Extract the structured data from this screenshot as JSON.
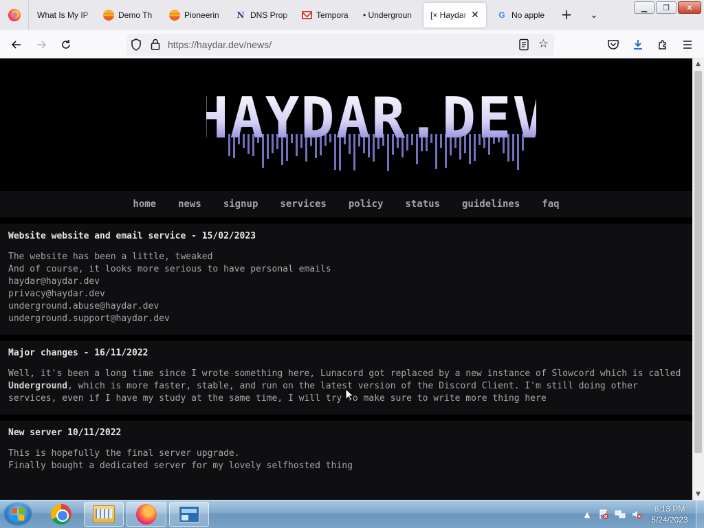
{
  "browser": {
    "tabs": [
      {
        "label": "What Is My IP",
        "favicon": "firefox-icon"
      },
      {
        "label": "Demo Th",
        "favicon": "sunset-icon"
      },
      {
        "label": "Pioneerin",
        "favicon": "sunset-icon"
      },
      {
        "label": "DNS Prop",
        "favicon": "n-logo-icon"
      },
      {
        "label": "Tempora",
        "favicon": "mail-icon"
      },
      {
        "label": "• Undergroun",
        "favicon": "none"
      },
      {
        "label": "[× Haydar",
        "favicon": "none",
        "active": true
      },
      {
        "label": "No apple",
        "favicon": "google-icon"
      }
    ],
    "url_host": "https://haydar.dev",
    "url_path": "/news/"
  },
  "site": {
    "logo_text": "HAYDAR.DEV",
    "nav": [
      "home",
      "news",
      "signup",
      "services",
      "policy",
      "status",
      "guidelines",
      "faq"
    ],
    "posts": [
      {
        "title": "Website website and email service - 15/02/2023",
        "lines": [
          "The website has been a little, tweaked",
          "And of course, it looks more serious to have personal emails",
          "haydar@haydar.dev",
          "privacy@haydar.dev",
          "underground.abuse@haydar.dev",
          "underground.support@haydar.dev"
        ]
      },
      {
        "title": "Major changes - 16/11/2022",
        "text_before_bold": "Well, it's been a long time since I wrote something here, Lunacord got replaced by a new instance of Slowcord which is called ",
        "bold": "Underground",
        "text_after_bold": ", which is more faster, stable, and run on the latest version of the Discord Client. I'm still doing other services, even if I have my study at the same time, I will try to make sure to write more thing here"
      },
      {
        "title": "New server 10/11/2022",
        "lines": [
          "This is hopefully the final server upgrade.",
          "Finally bought a dedicated server for my lovely selfhosted thing"
        ]
      }
    ]
  },
  "taskbar": {
    "time": "6:13 PM",
    "date": "5/24/2023"
  },
  "colors": {
    "page_bg": "#000000",
    "panel_bg": "#0f0f12",
    "nav_link": "#a4a4a8",
    "post_text": "#a6a6a6"
  }
}
